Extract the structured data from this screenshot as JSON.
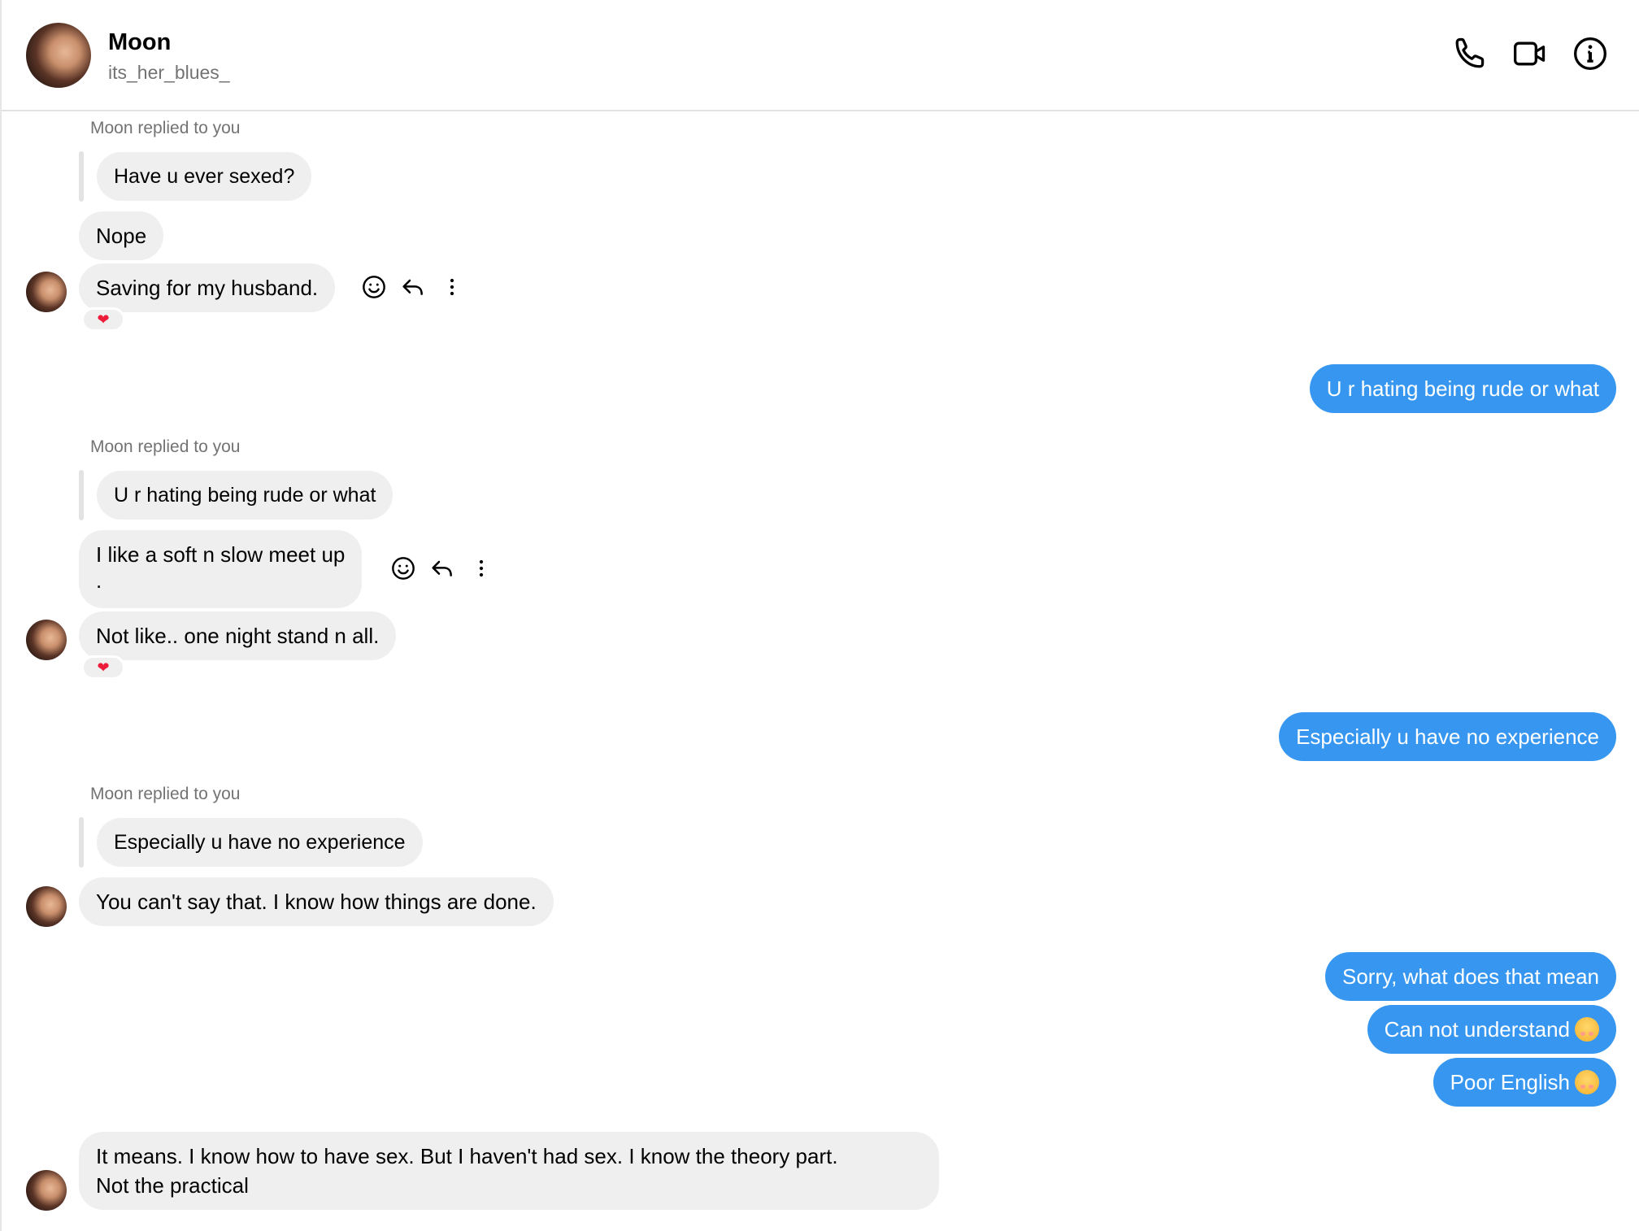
{
  "header": {
    "name": "Moon",
    "handle": "its_her_blues_",
    "icons": [
      "phone-icon",
      "video-call-icon",
      "info-icon"
    ]
  },
  "messages": {
    "group1": {
      "reply_note": "Moon replied to you",
      "quoted": "Have u ever sexed?",
      "m1": "Nope",
      "m2": "Saving for my husband.",
      "reaction": "❤"
    },
    "out1": "U r hating being rude or what",
    "group2": {
      "reply_note": "Moon replied to you",
      "quoted": "U r hating being rude or what",
      "m1_line1": "I like a soft n slow meet up",
      "m1_line2": ".",
      "m2": "Not like.. one night stand n all.",
      "reaction": "❤"
    },
    "out2": "Especially u have no experience",
    "group3": {
      "reply_note": "Moon replied to you",
      "quoted": "Especially u have no experience",
      "m1": "You can't say that. I know how things are done."
    },
    "out3": "Sorry, what does that mean",
    "out4": "Can not understand",
    "out5": "Poor English",
    "group4": {
      "m1_line1": "It means. I know how to have sex. But I haven't had sex. I know the theory part.",
      "m1_line2": "Not the practical"
    }
  },
  "colors": {
    "outgoing_bubble": "#3797f0",
    "incoming_bubble": "#efefef",
    "reaction_heart": "#ed1d3a"
  }
}
